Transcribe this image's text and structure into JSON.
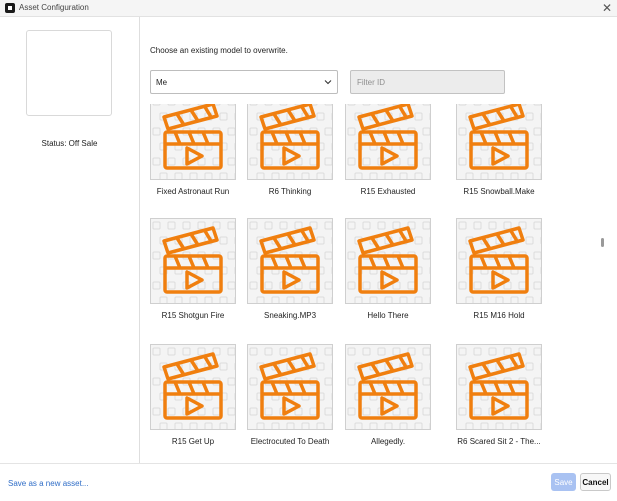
{
  "window": {
    "title": "Asset Configuration",
    "close_glyph": "✕"
  },
  "left_panel": {
    "status": "Status: Off Sale"
  },
  "main": {
    "prompt": "Choose an existing model to overwrite.",
    "owner_select": {
      "value": "Me"
    },
    "filter": {
      "placeholder": "Filter ID",
      "value": ""
    }
  },
  "assets": [
    {
      "label": "Fixed Astronaut Run",
      "icon": "clapperboard-icon"
    },
    {
      "label": "R6 Thinking",
      "icon": "clapperboard-icon"
    },
    {
      "label": "R15 Exhausted",
      "icon": "clapperboard-icon"
    },
    {
      "label": "R15 Snowball.Make",
      "icon": "clapperboard-icon"
    },
    {
      "label": "R15 Shotgun Fire",
      "icon": "clapperboard-icon"
    },
    {
      "label": "Sneaking.MP3",
      "icon": "clapperboard-icon"
    },
    {
      "label": "Hello There",
      "icon": "clapperboard-icon"
    },
    {
      "label": "R15 M16 Hold",
      "icon": "clapperboard-icon"
    },
    {
      "label": "R15 Get Up",
      "icon": "clapperboard-icon"
    },
    {
      "label": "Electrocuted To Death",
      "icon": "clapperboard-icon"
    },
    {
      "label": "Allegedly.",
      "icon": "clapperboard-icon"
    },
    {
      "label": "R6 Scared Sit 2 - The...",
      "icon": "clapperboard-icon"
    }
  ],
  "footer": {
    "save_new_label": "Save as a new asset...",
    "save_label": "Save",
    "cancel_label": "Cancel"
  },
  "colors": {
    "accent": "#f07f0f",
    "link": "#2f6dc7",
    "save_disabled": "#a9c2f2"
  }
}
